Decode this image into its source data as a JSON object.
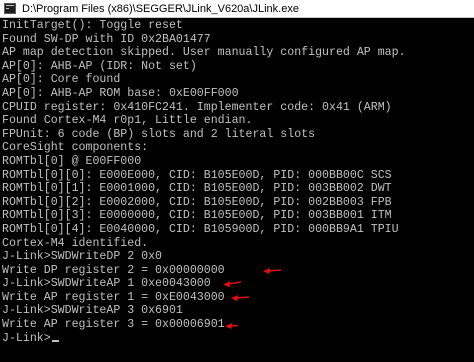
{
  "window": {
    "title": "D:\\Program Files (x86)\\SEGGER\\JLink_V620a\\JLink.exe"
  },
  "console": {
    "lines": [
      "InitTarget(): Toggle reset",
      "Found SW-DP with ID 0x2BA01477",
      "AP map detection skipped. User manually configured AP map.",
      "AP[0]: AHB-AP (IDR: Not set)",
      "AP[0]: Core found",
      "AP[0]: AHB-AP ROM base: 0xE00FF000",
      "CPUID register: 0x410FC241. Implementer code: 0x41 (ARM)",
      "Found Cortex-M4 r0p1, Little endian.",
      "FPUnit: 6 code (BP) slots and 2 literal slots",
      "CoreSight components:",
      "ROMTbl[0] @ E00FF000",
      "ROMTbl[0][0]: E000E000, CID: B105E00D, PID: 000BB00C SCS",
      "ROMTbl[0][1]: E0001000, CID: B105E00D, PID: 003BB002 DWT",
      "ROMTbl[0][2]: E0002000, CID: B105E00D, PID: 002BB003 FPB",
      "ROMTbl[0][3]: E0000000, CID: B105E00D, PID: 003BB001 ITM",
      "ROMTbl[0][4]: E0040000, CID: B105900D, PID: 000BB9A1 TPIU",
      "Cortex-M4 identified.",
      "J-Link>SWDWriteDP 2 0x0",
      "Write DP register 2 = 0x00000000",
      "J-Link>SWDWriteAP 1 0xe0043000",
      "Write AP register 1 = 0xE0043000",
      "J-Link>SWDWriteAP 3 0x6901",
      "Write AP register 3 = 0x00006901",
      "J-Link>"
    ]
  },
  "colors": {
    "console_text": "#c0c0c0",
    "console_background": "#000000",
    "annotation_arrow": "#e01010"
  },
  "annotations": [
    {
      "icon": "red-arrow-icon",
      "points_to_line": 18
    },
    {
      "icon": "red-arrow-icon",
      "points_to_line": 19
    },
    {
      "icon": "red-arrow-icon",
      "points_to_line": 20
    },
    {
      "icon": "red-arrow-icon",
      "points_to_line": 22
    }
  ]
}
